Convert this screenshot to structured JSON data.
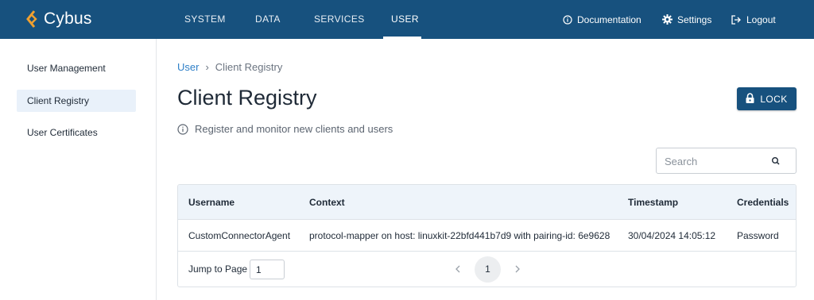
{
  "app": {
    "brand": "Cybus"
  },
  "nav": {
    "items": [
      {
        "label": "SYSTEM"
      },
      {
        "label": "DATA"
      },
      {
        "label": "SERVICES"
      },
      {
        "label": "USER",
        "active": true
      }
    ]
  },
  "top_actions": {
    "documentation": "Documentation",
    "settings": "Settings",
    "logout": "Logout"
  },
  "sidebar": {
    "items": [
      {
        "label": "User Management"
      },
      {
        "label": "Client Registry",
        "active": true
      },
      {
        "label": "User Certificates"
      }
    ]
  },
  "breadcrumb": {
    "parent": "User",
    "separator": "›",
    "current": "Client Registry"
  },
  "page": {
    "title": "Client Registry",
    "subtitle": "Register and monitor new clients and users",
    "lock_label": "LOCK"
  },
  "search": {
    "placeholder": "Search",
    "value": ""
  },
  "table": {
    "columns": [
      "Username",
      "Context",
      "Timestamp",
      "Credentials"
    ],
    "rows": [
      {
        "username": "CustomConnectorAgent",
        "context": "protocol-mapper on host: linuxkit-22bfd441b7d9 with pairing-id: 6e9628",
        "timestamp": "30/04/2024 14:05:12",
        "credentials": "Password"
      }
    ]
  },
  "pagination": {
    "jump_label": "Jump to Page",
    "jump_value": "1",
    "current_page": "1"
  },
  "colors": {
    "primary": "#17517e",
    "accent_logo": "#f0a030",
    "link": "#2f80c8",
    "table_header_bg": "#eef4fa",
    "sidebar_active_bg": "#e9f1fa"
  },
  "icons": {
    "logo": "cybus-logo-icon",
    "documentation": "info-circle-icon",
    "settings": "gear-icon",
    "logout": "logout-icon",
    "lock": "lock-icon",
    "subtitle": "info-circle-icon",
    "search": "search-icon",
    "prev": "chevron-left-icon",
    "next": "chevron-right-icon"
  }
}
